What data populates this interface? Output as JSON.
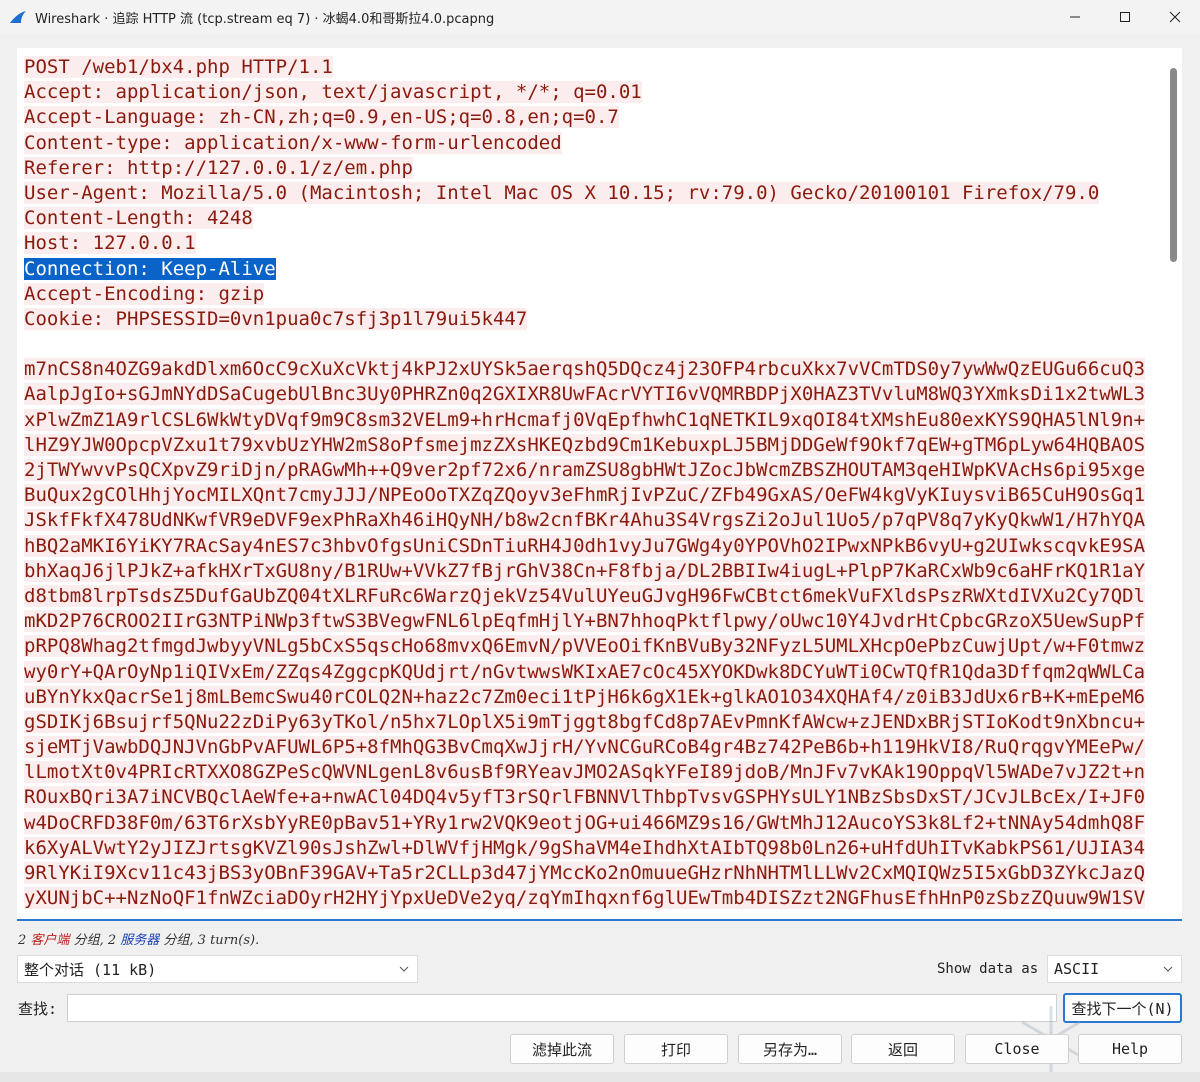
{
  "window": {
    "title": "Wireshark · 追踪 HTTP 流 (tcp.stream eq 7) · 冰蝎4.0和哥斯拉4.0.pcapng"
  },
  "stream": {
    "headers": [
      "POST /web1/bx4.php HTTP/1.1",
      "Accept: application/json, text/javascript, */*; q=0.01",
      "Accept-Language: zh-CN,zh;q=0.9,en-US;q=0.8,en;q=0.7",
      "Content-type: application/x-www-form-urlencoded",
      "Referer: http://127.0.0.1/z/em.php",
      "User-Agent: Mozilla/5.0 (Macintosh; Intel Mac OS X 10.15; rv:79.0) Gecko/20100101 Firefox/79.0",
      "Content-Length: 4248",
      "Host: 127.0.0.1",
      "Connection: Keep-Alive",
      "Accept-Encoding: gzip",
      "Cookie: PHPSESSID=0vn1pua0c7sfj3p1l79ui5k447"
    ],
    "selected_index": 8,
    "body": [
      "m7nCS8n4OZG9akdDlxm6OcC9cXuXcVktj4kPJ2xUYSk5aerqshQ5DQcz4j23OFP4rbcuXkx7vVCmTDS0y7ywWwQzEUGu66cuQ3",
      "AalpJgIo+sGJmNYdDSaCugebUlBnc3Uy0PHRZn0q2GXIXR8UwFAcrVYTI6vVQMRBDPjX0HAZ3TVvluM8WQ3YXmksDi1x2twWL3",
      "xPlwZmZ1A9rlCSL6WkWtyDVqf9m9C8sm32VELm9+hrHcmafj0VqEpfhwhC1qNETKIL9xqOI84tXMshEu80exKYS9QHA5lNl9n+",
      "lHZ9YJW0OpcpVZxu1t79xvbUzYHW2mS8oPfsmejmzZXsHKEQzbd9Cm1KebuxpLJ5BMjDDGeWf9Okf7qEW+gTM6pLyw64HQBAOS",
      "2jTWYwvvPsQCXpvZ9riDjn/pRAGwMh++Q9ver2pf72x6/nramZSU8gbHWtJZocJbWcmZBSZHOUTAM3qeHIWpKVAcHs6pi95xge",
      "BuQux2gCOlHhjYocMILXQnt7cmyJJJ/NPEoOoTXZqZQoyv3eFhmRjIvPZuC/ZFb49GxAS/OeFW4kgVyKIuysviB65CuH9OsGq1",
      "JSkfFkfX478UdNKwfVR9eDVF9exPhRaXh46iHQyNH/b8w2cnfBKr4Ahu3S4VrgsZi2oJul1Uo5/p7qPV8q7yKyQkwW1/H7hYQA",
      "hBQ2aMKI6YiKY7RAcSay4nES7c3hbvOfgsUniCSDnTiuRH4J0dh1vyJu7GWg4y0YPOVhO2IPwxNPkB6vyU+g2UIwkscqvkE9SA",
      "bhXaqJ6jlPJkZ+afkHXrTxGU8ny/B1RUw+VVkZ7fBjrGhV38Cn+F8fbja/DL2BBIIw4iugL+PlpP7KaRCxWb9c6aHFrKQ1R1aY",
      "d8tbm8lrpTsdsZ5DufGaUbZQ04tXLRFuRc6WarzQjekVz54VulUYeuGJvgH96FwCBtct6mekVuFXldsPszRWXtdIVXu2Cy7QDl",
      "mKD2P76CROO2IIrG3NTPiNWp3ftwS3BVegwFNL6lpEqfmHjlY+BN7hhoqPktflpwy/oUwc10Y4JvdrHtCpbcGRzoX5UewSupPf",
      "pRPQ8Whag2tfmgdJwbyyVNLg5bCxS5qscHo68mvxQ6EmvN/pVVEoOifKnBVuBy32NFyzL5UMLXHcpOePbzCuwjUpt/w+F0tmwz",
      "wy0rY+QArOyNp1iQIVxEm/ZZqs4ZggcpKQUdjrt/nGvtwwsWKIxAE7cOc45XYOKDwk8DCYuWTi0CwTQfR1Qda3Dffqm2qWWLCa",
      "uBYnYkxQacrSe1j8mLBemcSwu40rCOLQ2N+haz2c7Zm0eci1tPjH6k6gX1Ek+glkAO1O34XQHAf4/z0iB3JdUx6rB+K+mEpeM6",
      "gSDIKj6Bsujrf5QNu22zDiPy63yTKol/n5hx7LOplX5i9mTjggt8bgfCd8p7AEvPmnKfAWcw+zJENDxBRjSTIoKodt9nXbncu+",
      "sjeMTjVawbDQJNJVnGbPvAFUWL6P5+8fMhQG3BvCmqXwJjrH/YvNCGuRCoB4gr4Bz742PeB6b+h119HkVI8/RuQrqgvYMEePw/",
      "lLmotXt0v4PRIcRTXXO8GZPeScQWVNLgenL8v6usBf9RYeavJMO2ASqkYFeI89jdoB/MnJFv7vKAk19OppqVl5WADe7vJZ2t+n",
      "ROuxBQri3A7iNCVBQclAeWfe+a+nwACl04DQ4v5yfT3rSQrlFBNNVlThbpTvsvGSPHYsULY1NBzSbsDxST/JCvJLBcEx/I+JF0",
      "w4DoCRFD38F0m/63T6rXsbYyRE0pBav51+YRy1rw2VQK9eotjOG+ui466MZ9s16/GWtMhJ12AucoYS3k8Lf2+tNNAy54dmhQ8F",
      "k6XyALVwtY2yJIZJrtsgKVZl90sJshZwl+DlWVfjHMgk/9gShaVM4eIhdhXtAIbTQ98b0Ln26+uHfdUhITvKabkPS61/UJIA34",
      "9RlYKiI9Xcv11c43jBS3yOBnF39GAV+Ta5r2CLLp3d47jYMccKo2nOmuueGHzrNhNHTMlLLWv2CxMQIQWz5I5xGbD3ZYkcJazQ",
      "yXUNjbC++NzNoQF1fnWZciaDOyrH2HYjYpxUeDVe2yq/zqYmIhqxnf6glUEwTmb4DISZzt2NGFhusEfhHnP0zSbzZQuuw9W1SV"
    ]
  },
  "status": {
    "client_count": "2",
    "client_label": "客户端",
    "mid1": " 分组, ",
    "server_count": "2",
    "server_label": "服务器",
    "mid2": " 分组, 3 turn(s)."
  },
  "conversation_select": {
    "value": "整个对话 (11 kB)"
  },
  "show_data": {
    "label": "Show data as",
    "value": "ASCII"
  },
  "find": {
    "label": "查找:",
    "value": "",
    "next_button": "查找下一个(N)"
  },
  "buttons": {
    "filter_out": "滤掉此流",
    "print": "打印",
    "save_as": "另存为…",
    "back": "返回",
    "close": "Close",
    "help": "Help"
  },
  "colors": {
    "client_text": "#8a1a0e",
    "client_bg": "#fbeded",
    "selection": "#0a63c9",
    "accent": "#2b78d4"
  }
}
